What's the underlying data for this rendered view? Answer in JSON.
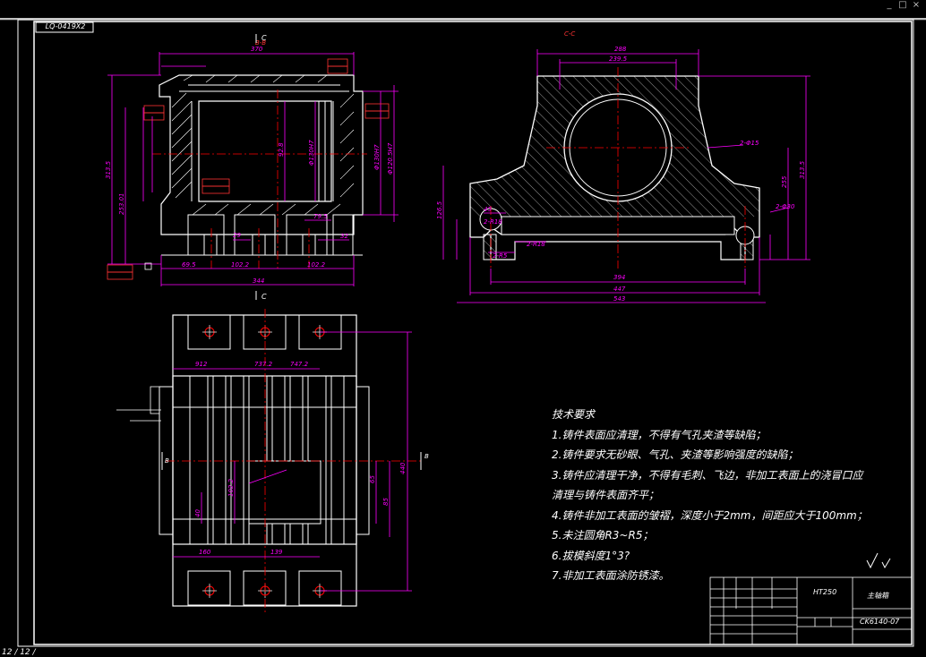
{
  "window": {
    "controls": [
      "_",
      "□",
      "×"
    ]
  },
  "drawing": {
    "id_label": "LQ-0419X2",
    "section_bb": "B-B",
    "section_cc": "C-C",
    "view_c": "C",
    "view_b": "B",
    "material": "HT250",
    "title_cell": "主轴箱",
    "part_number": "CK6140-07",
    "status_text": "12 / 12 /"
  },
  "tech_requirements": {
    "heading": "技术要求",
    "items": [
      "1.铸件表面应清理，不得有气孔夹渣等缺陷；",
      "2.铸件要求无砂眼、气孔、夹渣等影响强度的缺陷；",
      "3.铸件应清理干净，不得有毛刺、飞边，非加工表面上的浇冒口应",
      "清理与铸件表面齐平；",
      "4.铸件非加工表面的皱褶，深度小于2mm，间距应大于100mm；",
      "5.未注圆角R3~R5；",
      "6.拔模斜度1°3?",
      "7.非加工表面涂防锈漆。"
    ]
  },
  "dimensions": {
    "left_top": "370",
    "left_bottom_total": "344",
    "left_bottom_a": "69.5",
    "left_bottom_b": "102.2",
    "left_bottom_c": "102.2",
    "left_height": "313.5",
    "left_height2": "253.01",
    "left_inner": "92.8",
    "left_bore": "Φ130H7",
    "left_bore2": "Φ120.5H7",
    "right_top": "288",
    "right_top2": "239.5",
    "right_bottom1": "394",
    "right_bottom2": "447",
    "right_bottom3": "543",
    "right_height": "313.5",
    "right_h2": "255",
    "right_left_h": "126.5",
    "right_hole": "2-Φ15",
    "right_hole2": "2-Φ30",
    "right_hole3": "2-R18",
    "plan_w1": "912",
    "plan_w2": "737.2",
    "plan_w3": "747.2",
    "plan_height": "440",
    "plan_b1": "160",
    "plan_b2": "139",
    "plan_h1": "65",
    "plan_h2": "85",
    "plan_h3": "102.2"
  },
  "colors": {
    "geometry": "#ffffff",
    "dimension": "#ff00ff",
    "centerline": "#ff0000",
    "tolerance": "#ff3333",
    "border": "#ffffff"
  }
}
